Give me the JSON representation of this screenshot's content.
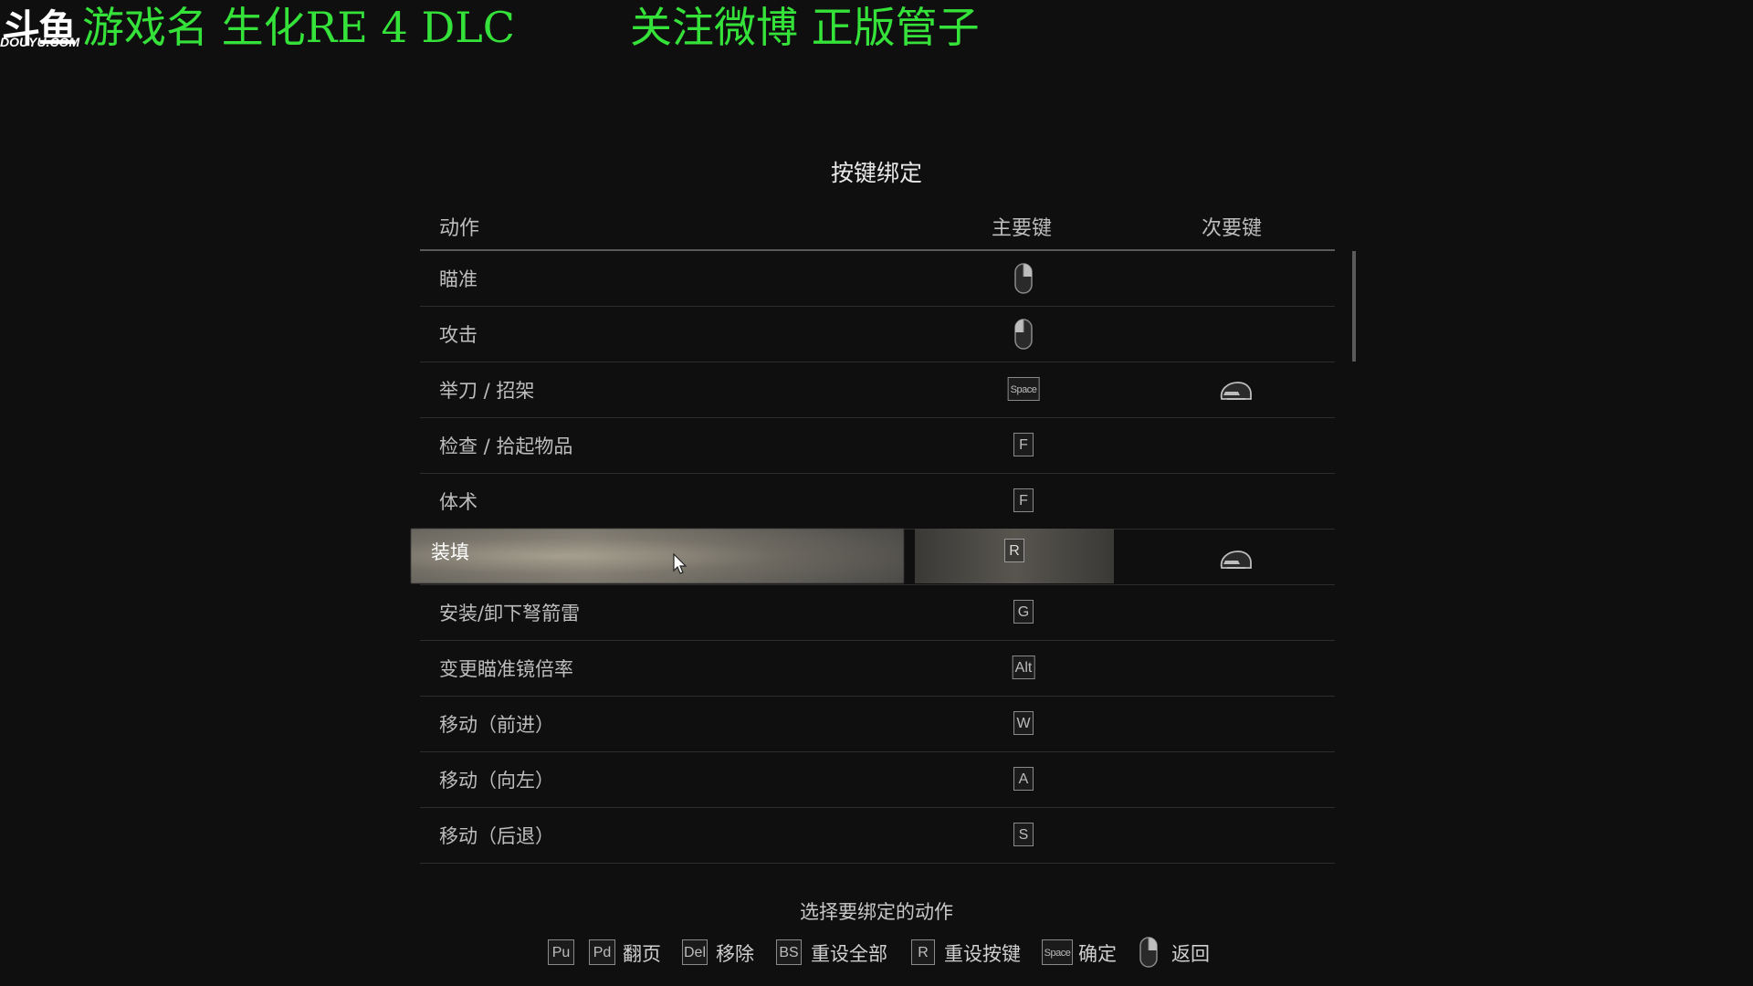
{
  "overlay": {
    "logo_cn": "斗鱼",
    "logo_en": "DOUYU.COM",
    "game_text": "游戏名  生化RE 4 DLC",
    "follow_text": "关注微博 正版管子"
  },
  "panel": {
    "title": "按键绑定",
    "columns": {
      "action": "动作",
      "primary": "主要键",
      "secondary": "次要键"
    },
    "rows": [
      {
        "label": "瞄准",
        "primary": "mouse-right-icon",
        "secondary": ""
      },
      {
        "label": "攻击",
        "primary": "mouse-left-icon",
        "secondary": ""
      },
      {
        "label": "举刀 / 招架",
        "primary": "Space",
        "secondary": "mouse-side-button-icon"
      },
      {
        "label": "检查 / 拾起物品",
        "primary": "F",
        "secondary": ""
      },
      {
        "label": "体术",
        "primary": "F",
        "secondary": ""
      },
      {
        "label": "装填",
        "primary": "R",
        "secondary": "mouse-side-button-icon",
        "selected": true
      },
      {
        "label": "安装/卸下弩箭雷",
        "primary": "G",
        "secondary": ""
      },
      {
        "label": "变更瞄准镜倍率",
        "primary": "Alt",
        "secondary": ""
      },
      {
        "label": "移动（前进）",
        "primary": "W",
        "secondary": ""
      },
      {
        "label": "移动（向左）",
        "primary": "A",
        "secondary": ""
      },
      {
        "label": "移动（后退）",
        "primary": "S",
        "secondary": ""
      }
    ]
  },
  "footer": {
    "hint": "选择要绑定的动作",
    "keys": {
      "page_up": "Pu",
      "page_down": "Pd",
      "delete": "Del",
      "backspace": "BS",
      "reset": "R",
      "space": "Space"
    },
    "labels": {
      "page": "翻页",
      "remove": "移除",
      "reset_all": "重设全部",
      "reset_key": "重设按键",
      "confirm": "确定",
      "back": "返回"
    }
  },
  "colors": {
    "background": "#0f0f0f",
    "overlay_green": "#35e23a",
    "text": "#bdbdbd",
    "highlight": "#8d887c"
  }
}
